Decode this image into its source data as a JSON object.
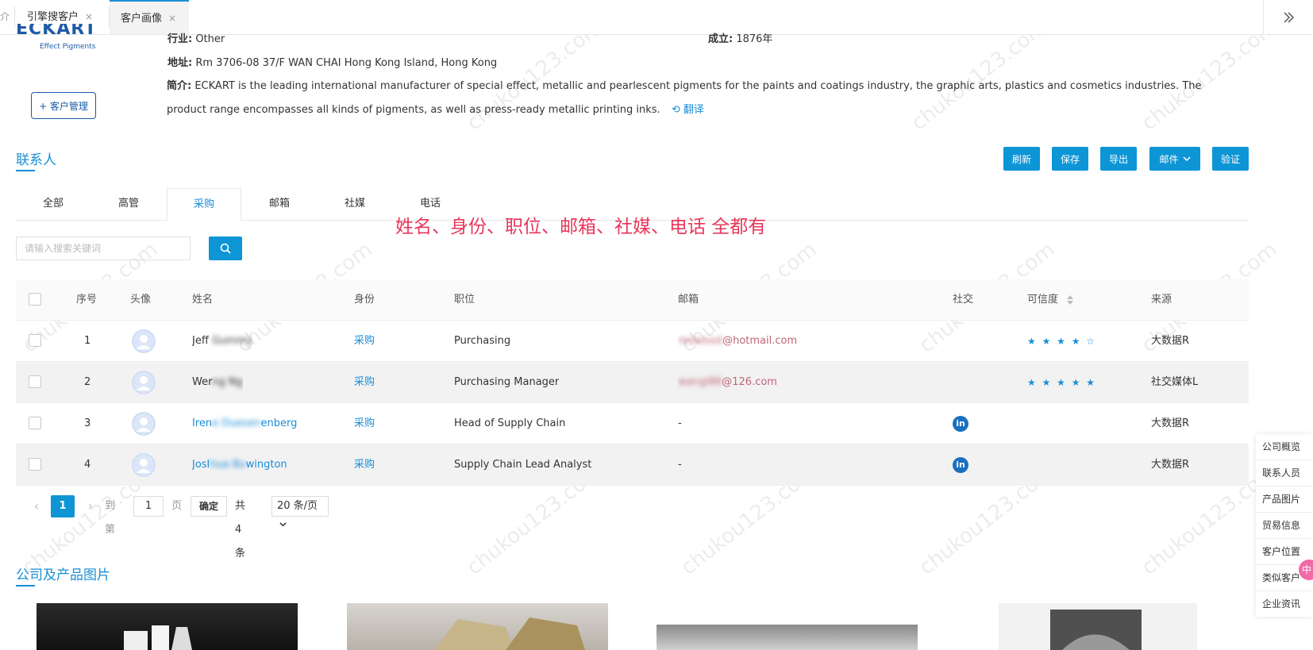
{
  "tabs": {
    "home_glyph": "介",
    "items": [
      {
        "label": "引擎搜客户",
        "close": "×"
      },
      {
        "label": "客户画像",
        "close": "×"
      }
    ]
  },
  "company": {
    "logo_text": "ECKART",
    "logo_sub": "Effect Pigments",
    "industry_label": "行业:",
    "industry_value": "Other",
    "founded_label": "成立:",
    "founded_value": "1876年",
    "address_label": "地址:",
    "address_value": "Rm 3706-08 37/F WAN CHAI Hong Kong Island, Hong Kong",
    "intro_label": "简介:",
    "intro_value": "ECKART is the leading international manufacturer of special effect, metallic and pearlescent pigments for the paints and coatings industry, the graphic arts, plastics and cosmetics industries. The product range encompasses all kinds of pigments, as well as press-ready metallic printing inks.",
    "translate": "翻译",
    "manage_button": "+ 客户管理"
  },
  "contacts": {
    "title": "联系人",
    "actions": {
      "refresh": "刷新",
      "save": "保存",
      "export": "导出",
      "mail": "邮件",
      "verify": "验证"
    },
    "tabs": [
      "全部",
      "高管",
      "采购",
      "邮箱",
      "社媒",
      "电话"
    ],
    "active_tab": "采购",
    "annotation": "姓名、身份、职位、邮箱、社媒、电话 全都有",
    "search_placeholder": "请输入搜索关键词",
    "columns": {
      "index": "序号",
      "avatar": "头像",
      "name": "姓名",
      "identity": "身份",
      "position": "职位",
      "email": "邮箱",
      "social": "社交",
      "credibility": "可信度",
      "source": "来源"
    },
    "rows": [
      {
        "index": "1",
        "name_visible": "Jeff",
        "name_blurred": "Gummy",
        "identity": "采购",
        "position": "Purchasing",
        "email_blurred": "redwood",
        "email_visible": "@hotmail.com",
        "social": "",
        "stars": "★ ★ ★ ★ ☆",
        "source": "大数据R"
      },
      {
        "index": "2",
        "name_visible": "Wer",
        "name_blurred": "ng Ng",
        "identity": "采购",
        "position": "Purchasing Manager",
        "email_blurred": "wangl88",
        "email_visible": "@126.com",
        "social": "",
        "stars": "★ ★ ★ ★ ★",
        "source": "社交媒体L"
      },
      {
        "index": "3",
        "name_visible": "Iren",
        "name_blurred": "e Duesen",
        "name_tail": "enberg",
        "identity": "采购",
        "position": "Head of Supply Chain",
        "email_blurred": "",
        "email_visible": "-",
        "social": "in",
        "stars": "",
        "source": "大数据R"
      },
      {
        "index": "4",
        "name_visible": "Josl",
        "name_blurred": "hua Bo",
        "name_tail": "wington",
        "identity": "采购",
        "position": "Supply Chain Lead Analyst",
        "email_blurred": "",
        "email_visible": "-",
        "social": "in",
        "stars": "",
        "source": "大数据R"
      }
    ],
    "pagination": {
      "prev": "‹",
      "page": "1",
      "next": "›",
      "goto_label": "到第",
      "goto_value": "1",
      "page_unit": "页",
      "confirm": "确定",
      "total": "共 4 条",
      "page_size": "20 条/页"
    }
  },
  "products": {
    "title": "公司及产品图片"
  },
  "side_nav": [
    "公司概览",
    "联系人员",
    "产品图片",
    "贸易信息",
    "客户位置",
    "类似客户",
    "企业资讯"
  ],
  "pink_badge": "中",
  "watermark": "chukou123.com",
  "colors": {
    "primary": "#0d95d6",
    "link": "#1a8ed6",
    "annotation": "#e8375b",
    "email": "#c0647a"
  }
}
